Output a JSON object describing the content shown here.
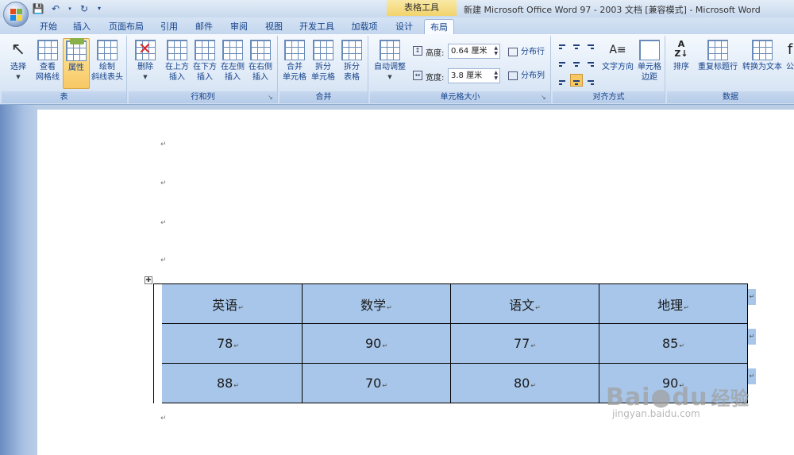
{
  "titlebar": {
    "context_label": "表格工具",
    "window_title": "新建 Microsoft Office Word 97 - 2003 文档 [兼容模式] - Microsoft Word"
  },
  "tabs": [
    "开始",
    "插入",
    "页面布局",
    "引用",
    "邮件",
    "审阅",
    "视图",
    "开发工具",
    "加载项",
    "设计",
    "布局"
  ],
  "active_tab": "布局",
  "ribbon": {
    "table_group": {
      "label": "表",
      "buttons": [
        "选择",
        "查看\n网格线",
        "属性",
        "绘制\n斜线表头"
      ]
    },
    "rows_cols_group": {
      "label": "行和列",
      "buttons": [
        "删除",
        "在上方\n插入",
        "在下方\n插入",
        "在左侧\n插入",
        "在右侧\n插入"
      ]
    },
    "merge_group": {
      "label": "合并",
      "buttons": [
        "合并\n单元格",
        "拆分\n单元格",
        "拆分\n表格"
      ]
    },
    "cell_size_group": {
      "label": "单元格大小",
      "autofit": "自动调整",
      "height_label": "高度:",
      "height_value": "0.64 厘米",
      "width_label": "宽度:",
      "width_value": "3.8 厘米",
      "distribute_rows": "分布行",
      "distribute_cols": "分布列"
    },
    "align_group": {
      "label": "对齐方式",
      "text_direction": "文字方向",
      "cell_margins": "单元格\n边距"
    },
    "data_group": {
      "label": "数据",
      "buttons": [
        "排序",
        "重复标题行",
        "转换为文本",
        "公"
      ]
    }
  },
  "table": {
    "rows": [
      [
        "英语",
        "数学",
        "语文",
        "地理"
      ],
      [
        "78",
        "90",
        "77",
        "85"
      ],
      [
        "88",
        "70",
        "80",
        "90"
      ]
    ]
  },
  "watermark": {
    "logo": "Bai",
    "logo2": "du",
    "cn": "经验",
    "url": "jingyan.baidu.com"
  },
  "colors": {
    "cell_fill": "#a7c6ea",
    "ribbon_accent": "#f8c865"
  }
}
